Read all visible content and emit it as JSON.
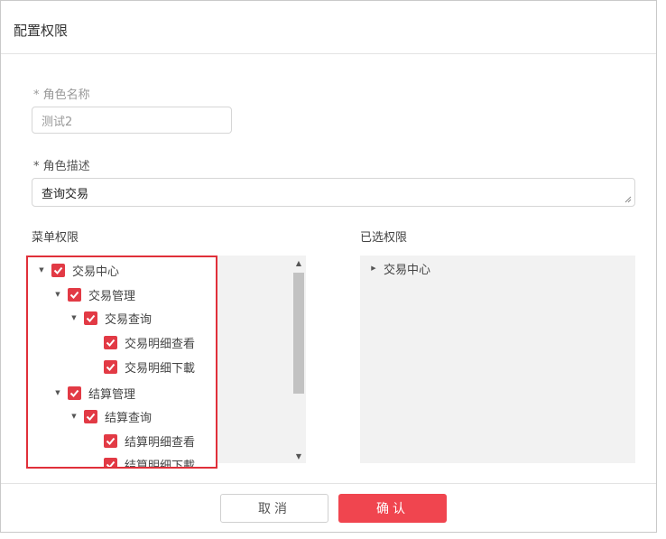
{
  "dialog": {
    "title": "配置权限"
  },
  "form": {
    "role_name_label": "* 角色名称",
    "role_name_value": "测试2",
    "role_desc_label": "* 角色描述",
    "role_desc_value": "查询交易"
  },
  "menu_permissions": {
    "label": "菜单权限",
    "tree": [
      {
        "label": "交易中心",
        "level": 0,
        "expanded": true,
        "checked": true
      },
      {
        "label": "交易管理",
        "level": 1,
        "expanded": true,
        "checked": true
      },
      {
        "label": "交易查询",
        "level": 2,
        "expanded": true,
        "checked": true
      },
      {
        "label": "交易明细查看",
        "level": 3,
        "leaf": true,
        "checked": true
      },
      {
        "label": "交易明细下載",
        "level": 3,
        "leaf": true,
        "checked": true
      },
      {
        "label": "结算管理",
        "level": 1,
        "expanded": true,
        "checked": true
      },
      {
        "label": "结算查询",
        "level": 2,
        "expanded": true,
        "checked": true
      },
      {
        "label": "结算明细查看",
        "level": 3,
        "leaf": true,
        "checked": true
      },
      {
        "label": "结算明细下載",
        "level": 3,
        "leaf": true,
        "checked": true
      }
    ]
  },
  "selected_permissions": {
    "label": "已选权限",
    "tree": [
      {
        "label": "交易中心",
        "expanded": false
      }
    ]
  },
  "buttons": {
    "cancel": "取消",
    "confirm": "确认"
  },
  "colors": {
    "accent": "#f0454f",
    "checkbox": "#e23a45",
    "highlight_border": "#e0303a",
    "panel_bg": "#f2f2f2"
  }
}
